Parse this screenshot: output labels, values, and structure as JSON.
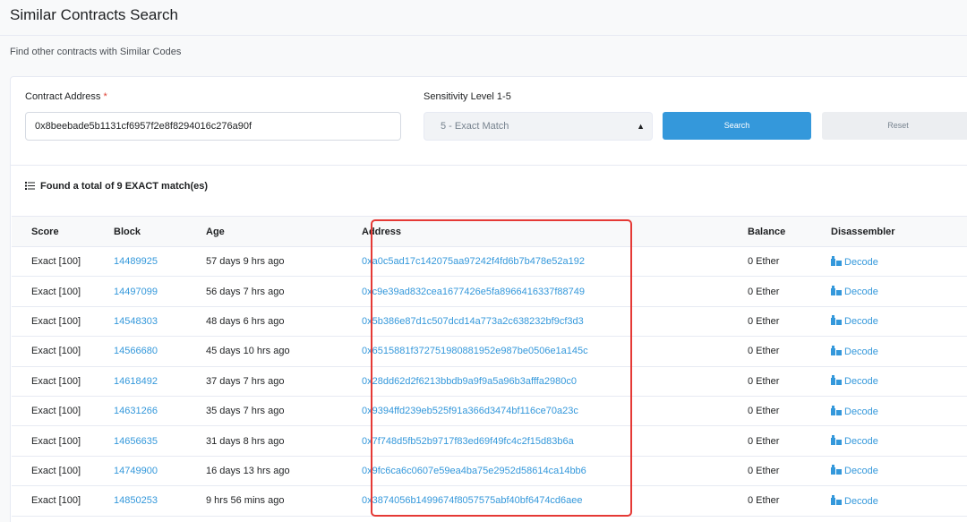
{
  "header": {
    "title": "Similar Contracts Search"
  },
  "subtitle": "Find other contracts with Similar Codes",
  "form": {
    "contract_label": "Contract Address",
    "required_mark": "*",
    "contract_value": "0x8beebade5b1131cf6957f2e8f8294016c276a90f",
    "sensitivity_label": "Sensitivity Level 1-5",
    "sensitivity_value": "5 - Exact Match",
    "search_label": "Search",
    "reset_label": "Reset"
  },
  "results": {
    "summary": "Found a total of 9 EXACT match(es)",
    "columns": [
      "Score",
      "Block",
      "Age",
      "Address",
      "Balance",
      "Disassembler"
    ],
    "rows": [
      {
        "score": "Exact [100]",
        "block": "14489925",
        "age": "57 days 9 hrs ago",
        "address": "0xa0c5ad17c142075aa97242f4fd6b7b478e52a192",
        "balance": "0 Ether",
        "decode": "Decode"
      },
      {
        "score": "Exact [100]",
        "block": "14497099",
        "age": "56 days 7 hrs ago",
        "address": "0xc9e39ad832cea1677426e5fa8966416337f88749",
        "balance": "0 Ether",
        "decode": "Decode"
      },
      {
        "score": "Exact [100]",
        "block": "14548303",
        "age": "48 days 6 hrs ago",
        "address": "0x5b386e87d1c507dcd14a773a2c638232bf9cf3d3",
        "balance": "0 Ether",
        "decode": "Decode"
      },
      {
        "score": "Exact [100]",
        "block": "14566680",
        "age": "45 days 10 hrs ago",
        "address": "0x6515881f372751980881952e987be0506e1a145c",
        "balance": "0 Ether",
        "decode": "Decode"
      },
      {
        "score": "Exact [100]",
        "block": "14618492",
        "age": "37 days 7 hrs ago",
        "address": "0x28dd62d2f6213bbdb9a9f9a5a96b3afffa2980c0",
        "balance": "0 Ether",
        "decode": "Decode"
      },
      {
        "score": "Exact [100]",
        "block": "14631266",
        "age": "35 days 7 hrs ago",
        "address": "0x9394ffd239eb525f91a366d3474bf116ce70a23c",
        "balance": "0 Ether",
        "decode": "Decode"
      },
      {
        "score": "Exact [100]",
        "block": "14656635",
        "age": "31 days 8 hrs ago",
        "address": "0x7f748d5fb52b9717f83ed69f49fc4c2f15d83b6a",
        "balance": "0 Ether",
        "decode": "Decode"
      },
      {
        "score": "Exact [100]",
        "block": "14749900",
        "age": "16 days 13 hrs ago",
        "address": "0x9fc6ca6c0607e59ea4ba75e2952d58614ca14bb6",
        "balance": "0 Ether",
        "decode": "Decode"
      },
      {
        "score": "Exact [100]",
        "block": "14850253",
        "age": "9 hrs 56 mins ago",
        "address": "0x3874056b1499674f8057575abf40bf6474cd6aee",
        "balance": "0 Ether",
        "decode": "Decode"
      }
    ]
  },
  "colors": {
    "link": "#3498db",
    "highlight": "#e53935",
    "search_button": "#3498db"
  },
  "icons": {
    "list": "list-icon",
    "decode": "puzzle-icon",
    "caret": "sort-caret-icon"
  }
}
